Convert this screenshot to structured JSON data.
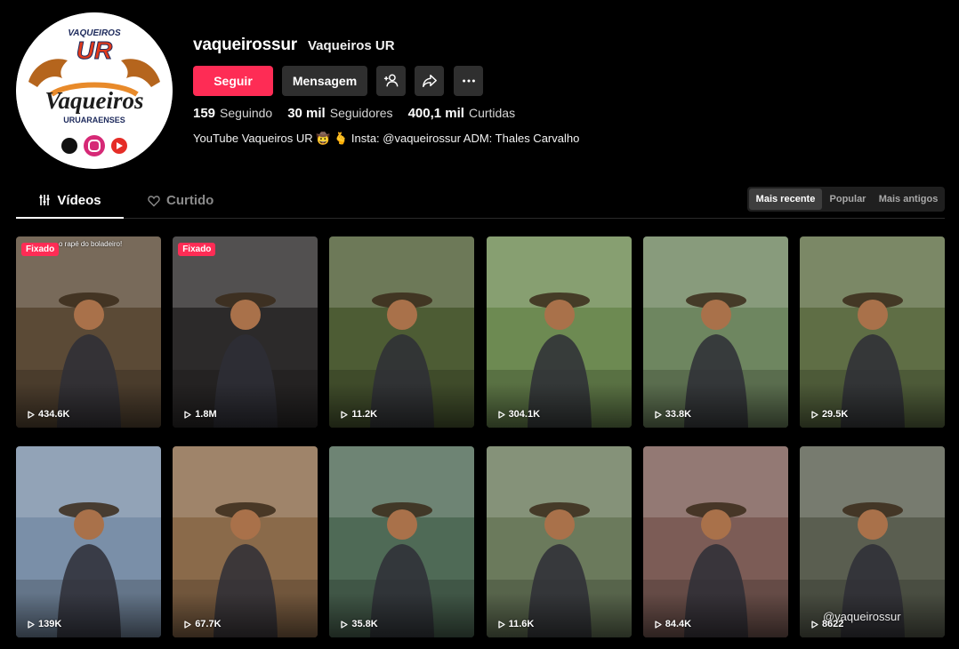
{
  "profile": {
    "username": "vaqueirossur",
    "nickname": "Vaqueiros UR",
    "follow_label": "Seguir",
    "message_label": "Mensagem",
    "stats": [
      {
        "value": "159",
        "label": "Seguindo"
      },
      {
        "value": "30 mil",
        "label": "Seguidores"
      },
      {
        "value": "400,1 mil",
        "label": "Curtidas"
      }
    ],
    "bio": "YouTube Vaqueiros UR 🤠 🫰 Insta: @vaqueirossur ADM: Thales Carvalho",
    "logo": {
      "top": "VAQUEIROS",
      "ur": "UR",
      "name": "Vaqueiros",
      "sub": "URUARAENSES"
    }
  },
  "tabs": [
    {
      "label": "Vídeos",
      "icon": "grid-icon"
    },
    {
      "label": "Curtido",
      "icon": "heart-icon"
    }
  ],
  "sort": [
    "Mais recente",
    "Popular",
    "Mais antigos"
  ],
  "videos": [
    {
      "views": "434.6K",
      "pinned": "Fixado",
      "caption": "o rapé do boladeiro!",
      "bg": "#5b4a36"
    },
    {
      "views": "1.8M",
      "pinned": "Fixado",
      "bg": "#2c2a2a"
    },
    {
      "views": "11.2K",
      "bg": "#4d5c34"
    },
    {
      "views": "304.1K",
      "bg": "#6d8a52"
    },
    {
      "views": "33.8K",
      "bg": "#6e8660"
    },
    {
      "views": "29.5K",
      "bg": "#5f6e45"
    },
    {
      "views": "139K",
      "bg": "#7a8fa8"
    },
    {
      "views": "67.7K",
      "bg": "#8a6a4a"
    },
    {
      "views": "35.8K",
      "bg": "#4f6a56"
    },
    {
      "views": "11.6K",
      "bg": "#6b7a5c"
    },
    {
      "views": "84.4K",
      "bg": "#7c5c56"
    },
    {
      "views": "8622",
      "watermark": "@vaqueirossur",
      "bg": "#5a5e50"
    }
  ],
  "colors": {
    "accent": "#fe2c55",
    "button": "#2f2f2f"
  }
}
